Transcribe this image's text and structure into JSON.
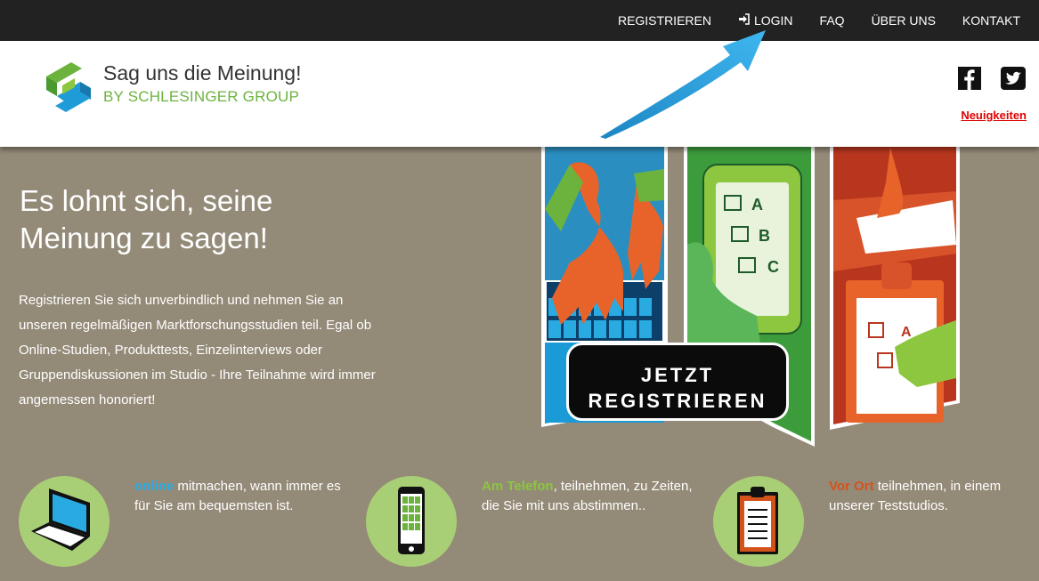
{
  "topnav": {
    "register": "REGISTRIEREN",
    "login": "LOGIN",
    "faq": "FAQ",
    "about": "ÜBER UNS",
    "contact": "KONTAKT"
  },
  "logo": {
    "title": "Sag uns die Meinung!",
    "subtitle": "BY SCHLESINGER GROUP"
  },
  "header": {
    "news_link": "Neuigkeiten"
  },
  "hero": {
    "title_line1": "Es lohnt sich, seine",
    "title_line2": "Meinung zu sagen!",
    "text": "Registrieren Sie sich unverbindlich und nehmen Sie an unseren regelmäßigen Marktforschungsstudien teil. Egal ob Online-Studien, Produkttests, Einzelinterviews oder Gruppendiskussionen im Studio - Ihre Teilnahme wird immer angemessen honoriert!",
    "cta_line1": "JETZT",
    "cta_line2": "REGISTRIEREN",
    "phone_options": [
      "A",
      "B",
      "C"
    ],
    "clipboard_option": "A"
  },
  "features": [
    {
      "highlight": "online",
      "rest": " mitmachen, wann immer es für Sie am bequemsten ist.",
      "color": "#29abe2"
    },
    {
      "highlight": "Am Telefon",
      "rest": ", teilnehmen, zu Zeiten, die Sie mit uns abstimmen..",
      "color": "#8cc63f"
    },
    {
      "highlight": "Vor Ort",
      "rest": " teilnehmen, in einem unserer Teststudios.",
      "color": "#d4531c"
    }
  ],
  "colors": {
    "background": "#948a78",
    "topbar": "#222222",
    "brand_green": "#6cb33e",
    "brand_blue": "#1f9bd7",
    "news_red": "#e00000"
  }
}
